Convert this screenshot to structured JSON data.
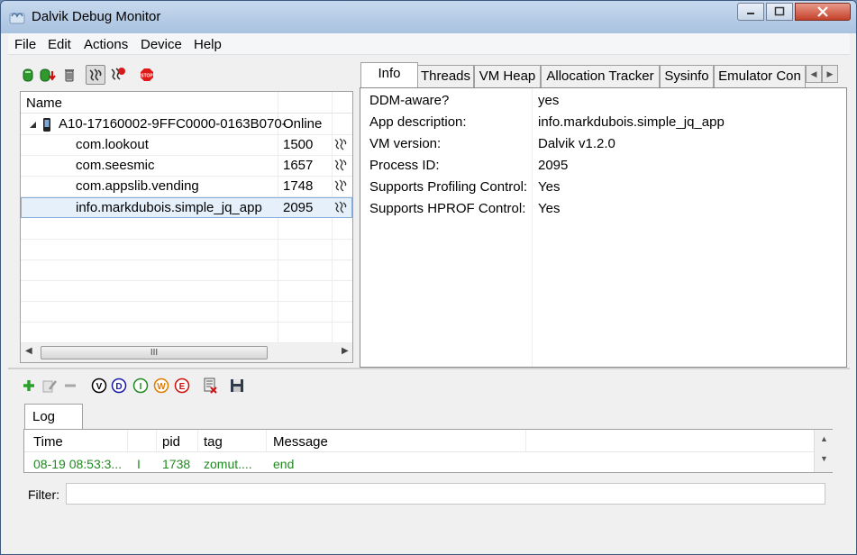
{
  "window": {
    "title": "Dalvik Debug Monitor"
  },
  "menu": [
    "File",
    "Edit",
    "Actions",
    "Device",
    "Help"
  ],
  "device_toolbar": [
    {
      "icon": "green-bug-icon"
    },
    {
      "icon": "green-bug-arrow-icon"
    },
    {
      "icon": "trash-can-icon"
    },
    {
      "icon": "threads-icon"
    },
    {
      "icon": "stop-threads-icon"
    },
    {
      "icon": "stop-icon"
    }
  ],
  "device_table": {
    "header": "Name",
    "device": {
      "name": "A10-17160002-9FFC0000-0163B070-",
      "status": "Online"
    },
    "processes": [
      {
        "name": "com.lookout",
        "pid": "1500"
      },
      {
        "name": "com.seesmic",
        "pid": "1657"
      },
      {
        "name": "com.appslib.vending",
        "pid": "1748"
      },
      {
        "name": "info.markdubois.simple_jq_app",
        "pid": "2095",
        "selected": true
      }
    ],
    "scroll_thumb": "III"
  },
  "tabs": [
    "Info",
    "Threads",
    "VM Heap",
    "Allocation Tracker",
    "Sysinfo",
    "Emulator Con"
  ],
  "info": [
    {
      "key": "DDM-aware?",
      "value": "yes"
    },
    {
      "key": "App description:",
      "value": "info.markdubois.simple_jq_app"
    },
    {
      "key": "VM version:",
      "value": "Dalvik v1.2.0"
    },
    {
      "key": "Process ID:",
      "value": "2095"
    },
    {
      "key": "Supports Profiling Control:",
      "value": "Yes"
    },
    {
      "key": "Supports HPROF Control:",
      "value": "Yes"
    }
  ],
  "log_toolbar": {
    "levels": [
      {
        "label": "V",
        "color": "#000000"
      },
      {
        "label": "D",
        "color": "#1a1aa8"
      },
      {
        "label": "I",
        "color": "#1f8a1f"
      },
      {
        "label": "W",
        "color": "#e07a00"
      },
      {
        "label": "E",
        "color": "#d01010"
      }
    ]
  },
  "log": {
    "tab": "Log",
    "columns": [
      "Time",
      "",
      "pid",
      "tag",
      "Message"
    ],
    "rows": [
      {
        "time": "08-19 08:53:3...",
        "level": "I",
        "pid": "1738",
        "tag": "zomut....",
        "message": "end"
      }
    ]
  },
  "filter": {
    "label": "Filter:",
    "value": ""
  }
}
